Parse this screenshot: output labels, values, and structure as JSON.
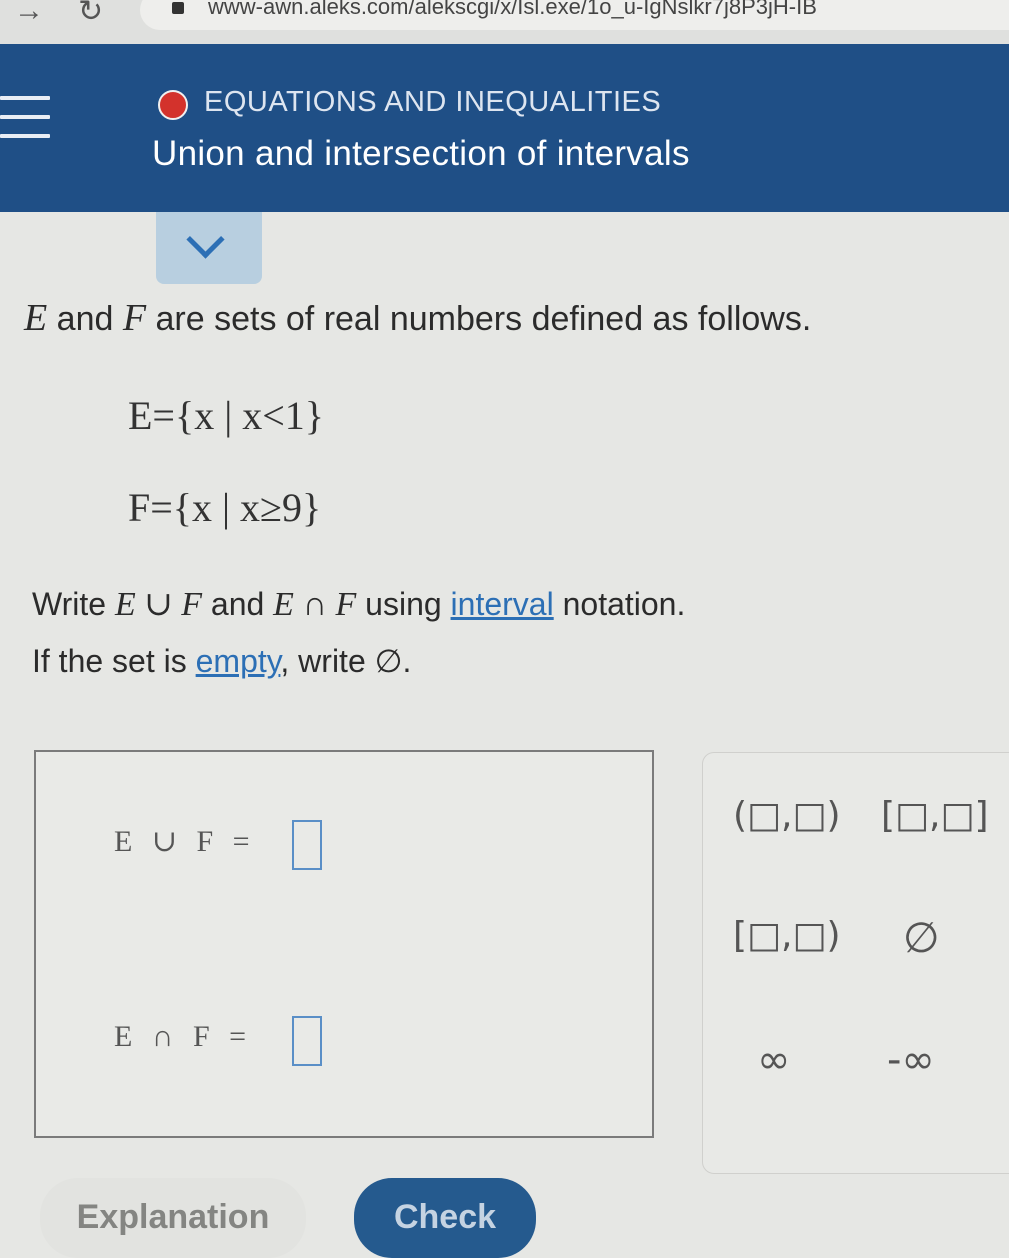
{
  "browser": {
    "url": "www-awn.aleks.com/alekscgi/x/Isl.exe/1o_u-IgNslkr7j8P3jH-IB"
  },
  "header": {
    "topic": "EQUATIONS AND INEQUALITIES",
    "title": "Union and intersection of intervals"
  },
  "problem": {
    "intro_mid1": " and ",
    "intro_mid2": " are sets of real numbers defined as follows.",
    "var_e": "E",
    "var_f": "F",
    "set_e": "E={x | x<1}",
    "set_f": "F={x | x≥9}",
    "instruction_part1": "Write ",
    "union_expr": "E ∪ F",
    "instruction_and": " and ",
    "inter_expr": "E ∩ F",
    "instruction_using": " using ",
    "interval_link": "interval",
    "instruction_end": " notation.",
    "empty_part1": "If the set is ",
    "empty_link": "empty",
    "empty_part2": ", write ∅."
  },
  "answers": {
    "union_label": "E ∪ F =",
    "inter_label": "E ∩ F =",
    "union_value": "",
    "inter_value": ""
  },
  "keypad": {
    "open_interval": "(□,□)",
    "closed_interval": "[□,□]",
    "half_open_interval": "[□,□)",
    "empty_set": "∅",
    "infinity": "∞",
    "neg_infinity": "-∞"
  },
  "buttons": {
    "explanation": "Explanation",
    "check": "Check"
  },
  "colors": {
    "header_bg": "#1f4f86",
    "topic_dot": "#d3322c",
    "link": "#2c6fb5",
    "check_bg": "#255a8e"
  },
  "icons": [
    "back-arrow-icon",
    "reload-icon",
    "lock-icon",
    "menu-icon",
    "chevron-down-icon"
  ]
}
